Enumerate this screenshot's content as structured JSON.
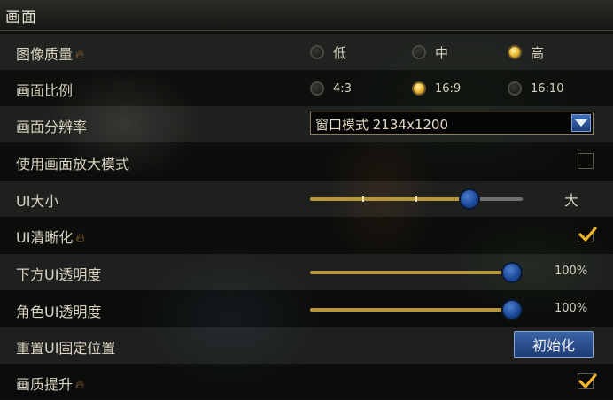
{
  "title": "画面",
  "image_quality": {
    "label": "图像质量",
    "options": [
      {
        "label": "低",
        "selected": false
      },
      {
        "label": "中",
        "selected": false
      },
      {
        "label": "高",
        "selected": true
      }
    ]
  },
  "aspect_ratio": {
    "label": "画面比例",
    "options": [
      {
        "label": "4:3",
        "selected": false
      },
      {
        "label": "16:9",
        "selected": true
      },
      {
        "label": "16:10",
        "selected": false
      }
    ]
  },
  "resolution": {
    "label": "画面分辨率",
    "value": "窗口模式 2134x1200"
  },
  "zoom_mode": {
    "label": "使用画面放大模式",
    "checked": false
  },
  "ui_size": {
    "label": "UI大小",
    "level": 0.75,
    "max_label": "大"
  },
  "ui_sharpen": {
    "label": "UI清晰化",
    "checked": true
  },
  "lower_ui_opacity": {
    "label": "下方UI透明度",
    "value": "100%",
    "level": 1.0
  },
  "char_ui_opacity": {
    "label": "角色UI透明度",
    "value": "100%",
    "level": 1.0
  },
  "reset_ui": {
    "label": "重置UI固定位置",
    "button": "初始化"
  },
  "quality_boost": {
    "label": "画质提升",
    "checked": true
  },
  "colors": {
    "accent": "#f0c040",
    "slider_fill": "#b8963c",
    "button": "#1d3c74"
  }
}
